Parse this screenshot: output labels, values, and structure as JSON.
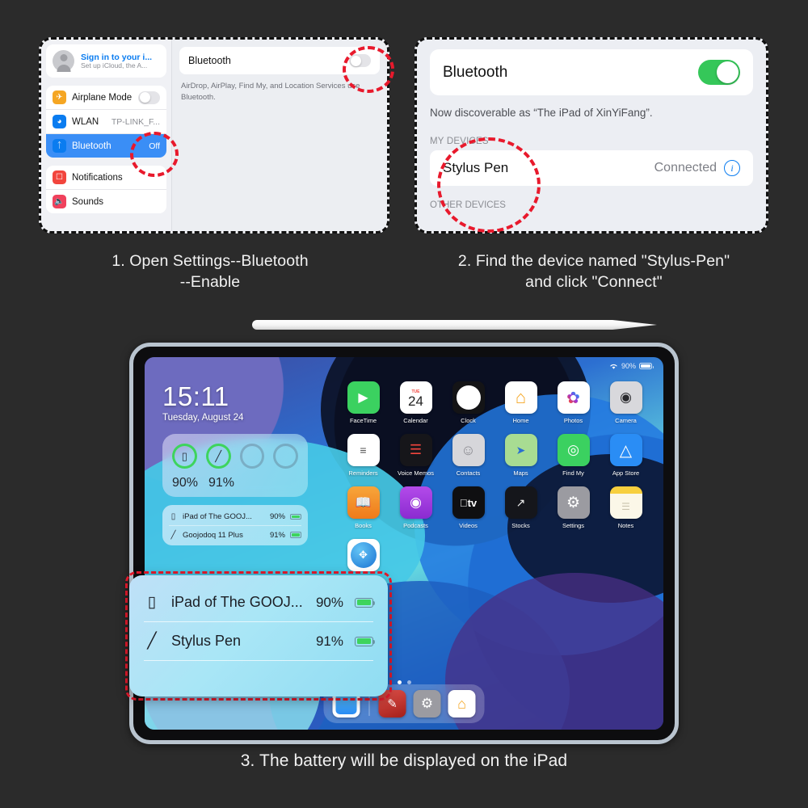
{
  "background_color": "#2b2b2b",
  "captions": {
    "step1": "1. Open Settings--Bluetooth\n--Enable",
    "step1_line1": "1. Open Settings--Bluetooth",
    "step1_line2": "--Enable",
    "step2_line1": "2. Find the device named \"Stylus-Pen\"",
    "step2_line2": "and click \"Connect\"",
    "step3": "3. The battery will be displayed on the iPad"
  },
  "panel1": {
    "account": {
      "title": "Sign in to your i...",
      "subtitle": "Set up iCloud, the A..."
    },
    "sidebar_items": [
      {
        "label": "Airplane Mode",
        "value": "",
        "icon": "airplane-icon",
        "icon_color": "#f5a623",
        "control": "toggle-off"
      },
      {
        "label": "WLAN",
        "value": "TP-LINK_F...",
        "icon": "wifi-icon",
        "icon_color": "#0a7cf0",
        "control": "value"
      },
      {
        "label": "Bluetooth",
        "value": "Off",
        "icon": "bluetooth-icon",
        "icon_color": "#0a7cf0",
        "control": "value",
        "selected": true
      }
    ],
    "sidebar_items2": [
      {
        "label": "Notifications",
        "icon": "notifications-icon",
        "icon_color": "#f2453d"
      },
      {
        "label": "Sounds",
        "icon": "sounds-icon",
        "icon_color": "#f0415c"
      }
    ],
    "detail": {
      "title": "Bluetooth",
      "toggle_state": "off",
      "note": "AirDrop, AirPlay, Find My, and Location Services use Bluetooth."
    }
  },
  "panel2": {
    "title": "Bluetooth",
    "toggle_state": "on",
    "toggle_color": "#35c759",
    "discoverable": "Now discoverable as “The iPad of XinYiFang”.",
    "my_devices_header": "MY DEVICES",
    "device": {
      "name": "Stylus Pen",
      "status": "Connected",
      "info_icon": "info-circle-icon"
    },
    "other_devices_header": "OTHER DEVICES"
  },
  "ipad": {
    "statusbar": {
      "wifi_icon": "wifi-icon",
      "battery_percent": "90%",
      "battery_icon": "battery-icon"
    },
    "lockclock": {
      "time": "15:11",
      "date": "Tuesday, August 24"
    },
    "battery_widget": {
      "rings": [
        {
          "glyph": "▭",
          "icon": "ipad-icon",
          "percent": "90%",
          "active": true
        },
        {
          "glyph": "╱",
          "icon": "stylus-icon",
          "percent": "91%",
          "active": true
        },
        {
          "glyph": "",
          "icon": "empty-ring",
          "percent": "",
          "active": false
        },
        {
          "glyph": "",
          "icon": "empty-ring",
          "percent": "",
          "active": false
        }
      ]
    },
    "device_widget": {
      "rows": [
        {
          "icon": "ipad-icon",
          "name": "iPad of The GOOJ...",
          "percent": "90%"
        },
        {
          "icon": "stylus-icon",
          "name": "Goojodoq 11 Plus",
          "percent": "91%"
        }
      ]
    },
    "apps_row1": [
      {
        "label": "FaceTime",
        "icon": "facetime-icon",
        "bg": "#3bd160",
        "glyph": "▶"
      },
      {
        "label": "Calendar",
        "icon": "calendar-icon",
        "bg": "#ffffff",
        "glyph": "24"
      },
      {
        "label": "Clock",
        "icon": "clock-icon",
        "bg": "#1b1b1b",
        "glyph": "○"
      },
      {
        "label": "Home",
        "icon": "home-icon",
        "bg": "#ffffff",
        "glyph": "⌂"
      },
      {
        "label": "Photos",
        "icon": "photos-icon",
        "bg": "#ffffff",
        "glyph": "✿"
      },
      {
        "label": "Camera",
        "icon": "camera-icon",
        "bg": "#d8d8dc",
        "glyph": "◎"
      }
    ],
    "apps_row2": [
      {
        "label": "Reminders",
        "icon": "reminders-icon",
        "bg": "#ffffff",
        "glyph": "≡"
      },
      {
        "label": "Voice Memos",
        "icon": "voice-memos-icon",
        "bg": "#1b1b1f",
        "glyph": "⌇"
      },
      {
        "label": "Contacts",
        "icon": "contacts-icon",
        "bg": "#d6d6da",
        "glyph": "☺"
      },
      {
        "label": "Maps",
        "icon": "maps-icon",
        "bg": "#9fd88a",
        "glyph": "➤"
      },
      {
        "label": "Find My",
        "icon": "find-my-icon",
        "bg": "#3bd160",
        "glyph": "◎"
      },
      {
        "label": "App Store",
        "icon": "app-store-icon",
        "bg": "#2a8df5",
        "glyph": "A"
      }
    ],
    "apps_row3": [
      {
        "label": "Books",
        "icon": "books-icon",
        "bg": "#f39024",
        "glyph": "▭"
      },
      {
        "label": "Podcasts",
        "icon": "podcasts-icon",
        "bg": "#9b34d8",
        "glyph": "◉"
      },
      {
        "label": "Videos",
        "icon": "videos-icon",
        "bg": "#0f0f11",
        "glyph": "tv"
      },
      {
        "label": "Stocks",
        "icon": "stocks-icon",
        "bg": "#15161b",
        "glyph": "↗"
      },
      {
        "label": "Settings",
        "icon": "settings-icon",
        "bg": "#9b9ba1",
        "glyph": "⚙"
      },
      {
        "label": "Notes",
        "icon": "notes-icon",
        "bg": "#fbf7e8",
        "glyph": "☰"
      }
    ],
    "apps_row4": [
      {
        "label": "Safari",
        "icon": "safari-icon",
        "bg": "#ffffff",
        "glyph": "◈"
      }
    ],
    "dock": [
      {
        "label": "Files",
        "icon": "files-icon",
        "bg": "#4fb3f0",
        "glyph": "▭"
      },
      {
        "label": "Procreate",
        "icon": "procreate-icon",
        "bg": "#c9312a",
        "glyph": "✎"
      },
      {
        "label": "Settings",
        "icon": "settings-icon",
        "bg": "#9b9ba1",
        "glyph": "⚙"
      },
      {
        "label": "Home",
        "icon": "home-icon",
        "bg": "#ffffff",
        "glyph": "⌂"
      }
    ],
    "page_dots": 2
  },
  "popup": {
    "rows": [
      {
        "icon": "ipad-icon",
        "name": "iPad of The GOOJ...",
        "percent": "90%",
        "battery_color": "#3ed45d"
      },
      {
        "icon": "stylus-icon",
        "name": "Stylus Pen",
        "percent": "91%",
        "battery_color": "#3ed45d"
      }
    ]
  },
  "annotations": {
    "highlight_color": "#e8192c",
    "stylus": "apple-pencil"
  }
}
